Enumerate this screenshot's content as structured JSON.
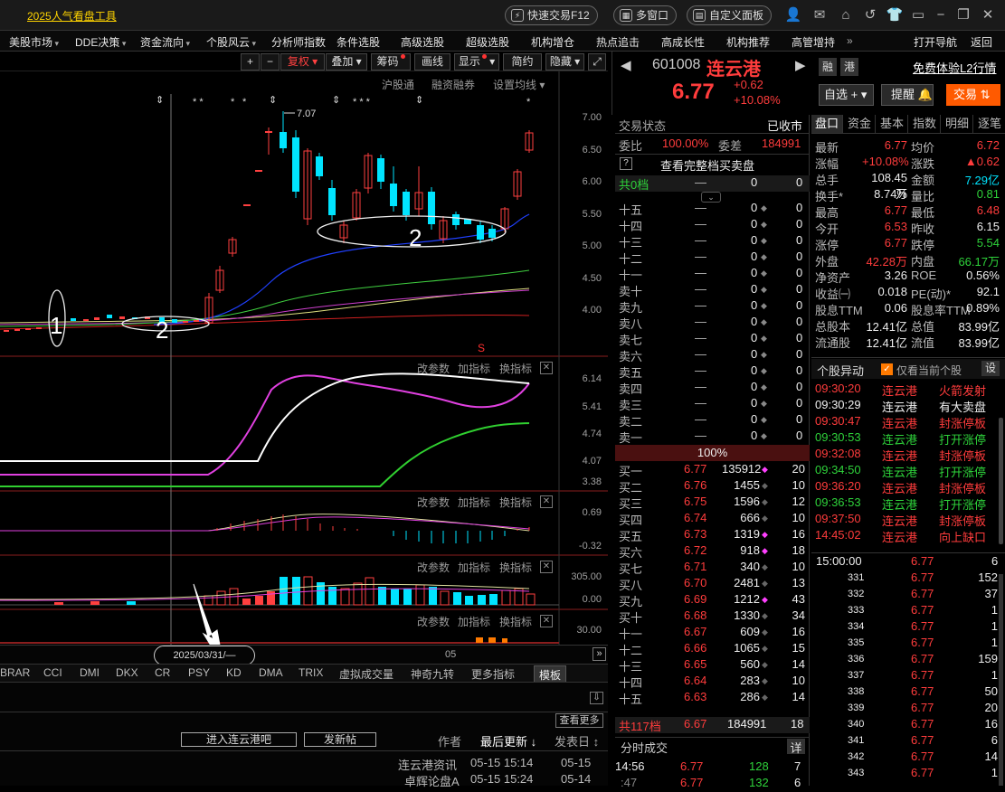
{
  "titlebar": {
    "app_title": "2025人气看盘工具",
    "quick_trade": "快速交易F12",
    "multi_window": "多窗口",
    "custom_panel": "自定义面板"
  },
  "menubar": {
    "items": [
      "美股市场",
      "DDE决策",
      "资金流向",
      "个股风云",
      "分析师指数",
      "条件选股",
      "高级选股",
      "超级选股",
      "机构增仓",
      "热点追击",
      "高成长性",
      "机构推荐",
      "高管增持"
    ],
    "more": "»",
    "open_nav": "打开导航",
    "back": "返回"
  },
  "chart_toolbar": {
    "plus": "+",
    "minus": "−",
    "fuquan": "复权",
    "overlay": "叠加",
    "chips": "筹码",
    "draw": "画线",
    "display": "显示",
    "simple": "简约",
    "hide": "隐藏"
  },
  "chart_links": {
    "hgt": "沪股通",
    "margin": "融资融券",
    "set_ma": "设置均线"
  },
  "price_axis": [
    "7.00",
    "6.50",
    "6.00",
    "5.50",
    "5.00",
    "4.50",
    "4.00"
  ],
  "annotations": {
    "high_label": "7.07",
    "marker1": "1",
    "marker2a": "2",
    "marker2b": "2",
    "s_mark": "S",
    "stars": "* ** * ** * * *** * *"
  },
  "sub1": {
    "params": "改参数",
    "add": "加指标",
    "switch": "换指标",
    "axis": [
      "6.14",
      "5.41",
      "4.74",
      "4.07",
      "3.38"
    ]
  },
  "sub2": {
    "params": "改参数",
    "add": "加指标",
    "switch": "换指标",
    "axis": [
      "0.69",
      "-0.32"
    ]
  },
  "sub3": {
    "params": "改参数",
    "add": "加指标",
    "switch": "换指标",
    "axis": [
      "305.00",
      "0.00"
    ]
  },
  "sub4": {
    "params": "改参数",
    "add": "加指标",
    "switch": "换指标",
    "axis": [
      "30.00"
    ]
  },
  "date_axis": {
    "cursor_date": "2025/03/31/—",
    "mid_label": "05",
    "next": "»"
  },
  "indicator_tabs": [
    "BRAR",
    "CCI",
    "DMI",
    "DKX",
    "CR",
    "PSY",
    "KD",
    "DMA",
    "TRIX",
    "虚拟成交量",
    "神奇九转",
    "更多指标"
  ],
  "template_tab": "模板",
  "bottom": {
    "more": "查看更多",
    "enter_forum": "进入连云港吧",
    "new_post": "发新帖",
    "col_author": "作者",
    "col_last": "最后更新",
    "col_post": "发表日",
    "posts": [
      {
        "title": "连云港资讯",
        "last": "05-15 15:14",
        "post": "05-15"
      },
      {
        "title": "卓辉论盘A",
        "last": "05-15 15:24",
        "post": "05-14"
      }
    ]
  },
  "quote": {
    "code": "601008",
    "name": "连云港",
    "price": "6.77",
    "change": "+0.62",
    "pct": "+10.08%",
    "rong": "融",
    "gang": "港",
    "l2": "免费体验L2行情",
    "watch": "自选",
    "remind": "提醒",
    "trade": "交易"
  },
  "orderbook": {
    "status_label": "交易状态",
    "status_value": "已收市",
    "ratio_label": "委比",
    "ratio_value": "100.00%",
    "diff_label": "委差",
    "diff_value": "184991",
    "help": "?",
    "full_book": "查看完整档买卖盘",
    "total_sell_label": "共0档",
    "total_sell_dash": "—",
    "total_sell_v1": "0",
    "total_sell_v2": "0",
    "sell_deep": [
      {
        "label": "十五",
        "price": "—",
        "vol": "0",
        "cnt": "0"
      },
      {
        "label": "十四",
        "price": "—",
        "vol": "0",
        "cnt": "0"
      },
      {
        "label": "十三",
        "price": "—",
        "vol": "0",
        "cnt": "0"
      },
      {
        "label": "十二",
        "price": "—",
        "vol": "0",
        "cnt": "0"
      },
      {
        "label": "十一",
        "price": "—",
        "vol": "0",
        "cnt": "0"
      },
      {
        "label": "卖十",
        "price": "—",
        "vol": "0",
        "cnt": "0"
      },
      {
        "label": "卖九",
        "price": "—",
        "vol": "0",
        "cnt": "0"
      },
      {
        "label": "卖八",
        "price": "—",
        "vol": "0",
        "cnt": "0"
      },
      {
        "label": "卖七",
        "price": "—",
        "vol": "0",
        "cnt": "0"
      },
      {
        "label": "卖六",
        "price": "—",
        "vol": "0",
        "cnt": "0"
      },
      {
        "label": "卖五",
        "price": "—",
        "vol": "0",
        "cnt": "0"
      },
      {
        "label": "卖四",
        "price": "—",
        "vol": "0",
        "cnt": "0"
      },
      {
        "label": "卖三",
        "price": "—",
        "vol": "0",
        "cnt": "0"
      },
      {
        "label": "卖二",
        "price": "—",
        "vol": "0",
        "cnt": "0"
      },
      {
        "label": "卖一",
        "price": "—",
        "vol": "0",
        "cnt": "0"
      }
    ],
    "mid_pct": "100%",
    "buys": [
      {
        "label": "买一",
        "price": "6.77",
        "vol": "135912",
        "cnt": "20",
        "mark": "◆"
      },
      {
        "label": "买二",
        "price": "6.76",
        "vol": "1455",
        "cnt": "10",
        "mark": "◆"
      },
      {
        "label": "买三",
        "price": "6.75",
        "vol": "1596",
        "cnt": "12",
        "mark": "◆"
      },
      {
        "label": "买四",
        "price": "6.74",
        "vol": "666",
        "cnt": "10",
        "mark": "◆"
      },
      {
        "label": "买五",
        "price": "6.73",
        "vol": "1319",
        "cnt": "16",
        "mark": "◆"
      },
      {
        "label": "买六",
        "price": "6.72",
        "vol": "918",
        "cnt": "18",
        "mark": "◆"
      },
      {
        "label": "买七",
        "price": "6.71",
        "vol": "340",
        "cnt": "10",
        "mark": "◆"
      },
      {
        "label": "买八",
        "price": "6.70",
        "vol": "2481",
        "cnt": "13",
        "mark": "◆"
      },
      {
        "label": "买九",
        "price": "6.69",
        "vol": "1212",
        "cnt": "43",
        "mark": "◆"
      },
      {
        "label": "买十",
        "price": "6.68",
        "vol": "1330",
        "cnt": "34",
        "mark": "◆"
      },
      {
        "label": "十一",
        "price": "6.67",
        "vol": "609",
        "cnt": "16",
        "mark": "◆"
      },
      {
        "label": "十二",
        "price": "6.66",
        "vol": "1065",
        "cnt": "15",
        "mark": "◆"
      },
      {
        "label": "十三",
        "price": "6.65",
        "vol": "560",
        "cnt": "14",
        "mark": "◆"
      },
      {
        "label": "十四",
        "price": "6.64",
        "vol": "283",
        "cnt": "10",
        "mark": "◆"
      },
      {
        "label": "十五",
        "price": "6.63",
        "vol": "286",
        "cnt": "14",
        "mark": "◆"
      }
    ],
    "total_buy_label": "共117档",
    "total_buy_price": "6.67",
    "total_buy_vol": "184991",
    "total_buy_cnt": "18",
    "ticks_title": "分时成交",
    "ticks_detail": "详",
    "ticks": [
      {
        "time": "14:56",
        "price": "6.77",
        "vol": "128",
        "cnt": "7"
      },
      {
        "time": ":47",
        "price": "6.77",
        "vol": "132",
        "cnt": "6"
      }
    ]
  },
  "stats": {
    "tabs": [
      "盘口",
      "资金",
      "基本",
      "指数",
      "明细",
      "逐笔"
    ],
    "rows": [
      {
        "l1": "最新",
        "v1": "6.77",
        "c1": "red",
        "l2": "均价",
        "v2": "6.72",
        "c2": "red"
      },
      {
        "l1": "涨幅",
        "v1": "+10.08%",
        "c1": "red",
        "l2": "涨跌",
        "v2": "▲0.62",
        "c2": "red"
      },
      {
        "l1": "总手",
        "v1": "108.45万",
        "c1": "white",
        "l2": "金额",
        "v2": "7.29亿",
        "c2": "cyan"
      },
      {
        "l1": "换手*",
        "v1": "8.74%",
        "c1": "white",
        "l2": "量比",
        "v2": "0.81",
        "c2": "green"
      },
      {
        "l1": "最高",
        "v1": "6.77",
        "c1": "red",
        "l2": "最低",
        "v2": "6.48",
        "c2": "red"
      },
      {
        "l1": "今开",
        "v1": "6.53",
        "c1": "red",
        "l2": "昨收",
        "v2": "6.15",
        "c2": "white"
      },
      {
        "l1": "涨停",
        "v1": "6.77",
        "c1": "red",
        "l2": "跌停",
        "v2": "5.54",
        "c2": "green"
      },
      {
        "l1": "外盘",
        "v1": "42.28万",
        "c1": "red",
        "l2": "内盘",
        "v2": "66.17万",
        "c2": "green"
      },
      {
        "l1": "净资产",
        "v1": "3.26",
        "c1": "white",
        "l2": "ROE",
        "v2": "0.56%",
        "c2": "white"
      },
      {
        "l1": "收益㈠",
        "v1": "0.018",
        "c1": "white",
        "l2": "PE(动)*",
        "v2": "92.1",
        "c2": "white"
      },
      {
        "l1": "股息TTM",
        "v1": "0.06",
        "c1": "white",
        "l2": "股息率TTM",
        "v2": "0.89%",
        "c2": "white"
      },
      {
        "l1": "总股本",
        "v1": "12.41亿",
        "c1": "white",
        "l2": "总值",
        "v2": "83.99亿",
        "c2": "white"
      },
      {
        "l1": "流通股",
        "v1": "12.41亿",
        "c1": "white",
        "l2": "流值",
        "v2": "83.99亿",
        "c2": "white"
      }
    ],
    "anomaly_title": "个股异动",
    "anomaly_only": "仅看当前个股",
    "anomaly_settings": "设",
    "anomalies": [
      {
        "time": "09:30:20",
        "name": "连云港",
        "event": "火箭发射",
        "c": "red"
      },
      {
        "time": "09:30:29",
        "name": "连云港",
        "event": "有大卖盘",
        "c": "white"
      },
      {
        "time": "09:30:47",
        "name": "连云港",
        "event": "封涨停板",
        "c": "red"
      },
      {
        "time": "09:30:53",
        "name": "连云港",
        "event": "打开涨停",
        "c": "green"
      },
      {
        "time": "09:32:08",
        "name": "连云港",
        "event": "封涨停板",
        "c": "red"
      },
      {
        "time": "09:34:50",
        "name": "连云港",
        "event": "打开涨停",
        "c": "green"
      },
      {
        "time": "09:36:20",
        "name": "连云港",
        "event": "封涨停板",
        "c": "red"
      },
      {
        "time": "09:36:53",
        "name": "连云港",
        "event": "打开涨停",
        "c": "green"
      },
      {
        "time": "09:37:50",
        "name": "连云港",
        "event": "封涨停板",
        "c": "red"
      },
      {
        "time": "14:45:02",
        "name": "连云港",
        "event": "向上缺口",
        "c": "red"
      }
    ],
    "ticks_header": {
      "time": "15:00:00",
      "price": "6.77",
      "vol": "6"
    },
    "ticks": [
      {
        "n": "331",
        "price": "6.77",
        "vol": "152"
      },
      {
        "n": "332",
        "price": "6.77",
        "vol": "37"
      },
      {
        "n": "333",
        "price": "6.77",
        "vol": "1"
      },
      {
        "n": "334",
        "price": "6.77",
        "vol": "1"
      },
      {
        "n": "335",
        "price": "6.77",
        "vol": "1"
      },
      {
        "n": "336",
        "price": "6.77",
        "vol": "159"
      },
      {
        "n": "337",
        "price": "6.77",
        "vol": "1"
      },
      {
        "n": "338",
        "price": "6.77",
        "vol": "50"
      },
      {
        "n": "339",
        "price": "6.77",
        "vol": "20"
      },
      {
        "n": "340",
        "price": "6.77",
        "vol": "16"
      },
      {
        "n": "341",
        "price": "6.77",
        "vol": "6"
      },
      {
        "n": "342",
        "price": "6.77",
        "vol": "14"
      },
      {
        "n": "343",
        "price": "6.77",
        "vol": "1"
      }
    ]
  },
  "colors": {
    "up": "#ff3c3c",
    "down": "#00e4ff",
    "brand_yellow": "#ffd400",
    "trade_orange": "#ff5a00"
  }
}
